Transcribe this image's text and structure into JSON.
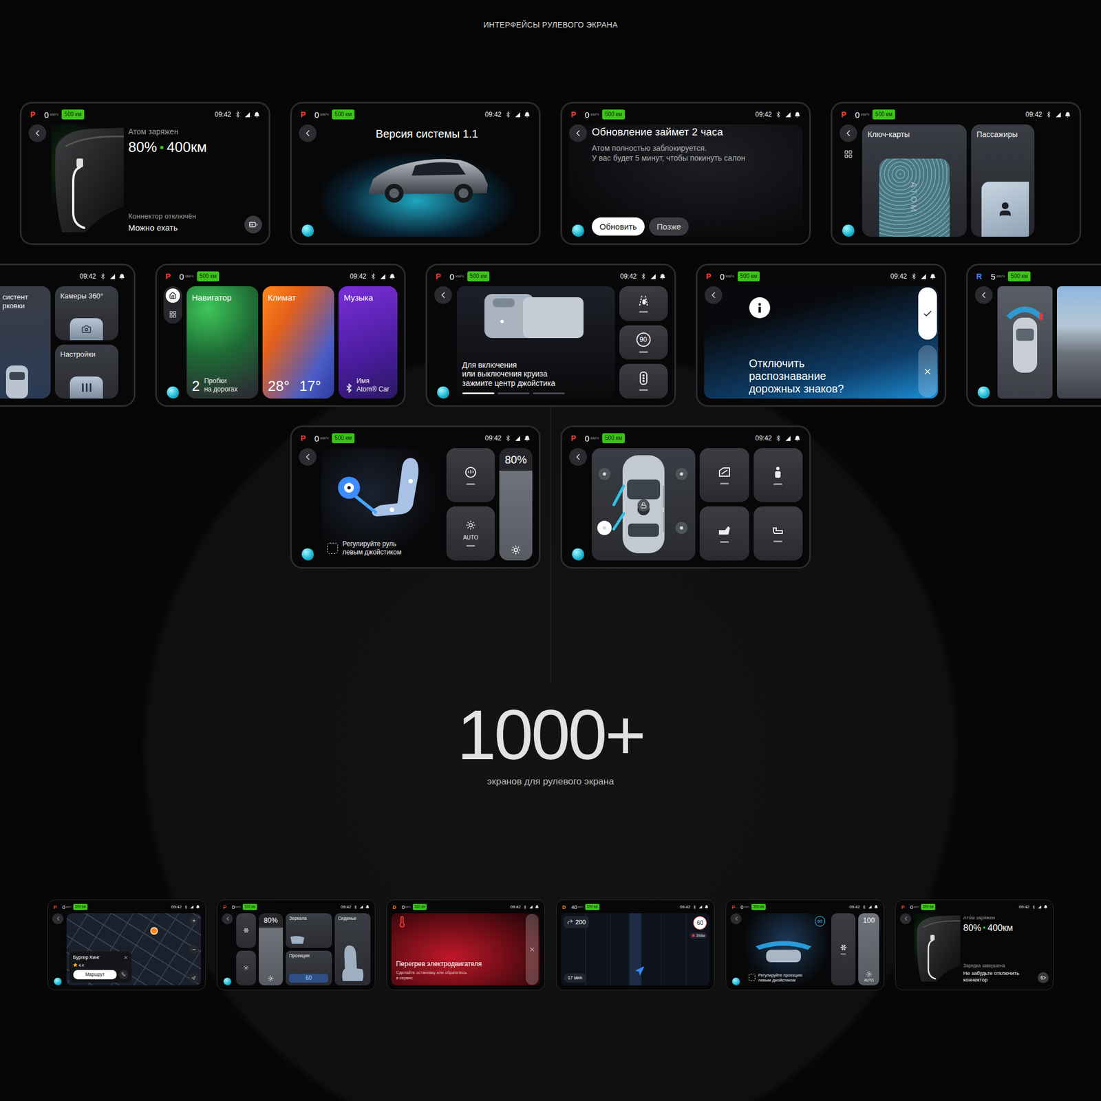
{
  "header": {
    "title": "ИНТЕРФЕЙСЫ РУЛЕВОГО ЭКРАНА"
  },
  "rows": [
    [
      {
        "kind": "charge",
        "status": {
          "gear": "P",
          "gear_color": "#ff3b30",
          "speed": "0",
          "unit": "км/ч",
          "range": "500 км",
          "time": "09:42"
        },
        "title": "Атом заряжен",
        "charge": "80%",
        "range": "400км",
        "note": "Коннектор отключён",
        "message": "Можно ехать"
      },
      {
        "kind": "version",
        "status": {
          "gear": "P",
          "gear_color": "#ff3b30",
          "speed": "0",
          "unit": "км/ч",
          "range": "500 км",
          "time": "09:42"
        },
        "title": "Версия системы 1.1"
      },
      {
        "kind": "update",
        "status": {
          "gear": "P",
          "gear_color": "#ff3b30",
          "speed": "0",
          "unit": "км/ч",
          "range": "500 км",
          "time": "09:42"
        },
        "title": "Обновление займет 2 часа",
        "lines": [
          "Атом полностью заблокируется.",
          "У вас будет 5 минут, чтобы покинуть салон"
        ],
        "buttons": [
          {
            "label": "Обновить",
            "primary": true
          },
          {
            "label": "Позже",
            "primary": false
          }
        ]
      },
      {
        "kind": "keys",
        "status": {
          "gear": "P",
          "gear_color": "#ff3b30",
          "speed": "0",
          "unit": "км/ч",
          "range": "500 км",
          "time": "09:42"
        },
        "cards": [
          {
            "label": "Ключ-карты",
            "card_text": "ATOM"
          },
          {
            "label": "Пассажиры"
          }
        ]
      }
    ],
    [
      {
        "kind": "apps",
        "status": {
          "time": "09:42"
        },
        "tiles": [
          {
            "lines": [
              "систент",
              "рковки"
            ]
          },
          {
            "lines": [
              "Камеры 360°"
            ]
          },
          {
            "lines": [
              "Настройки"
            ]
          }
        ]
      },
      {
        "kind": "home",
        "status": {
          "gear": "P",
          "gear_color": "#ff3b30",
          "speed": "0",
          "unit": "км/ч",
          "range": "500 км",
          "time": "09:42"
        },
        "nav": [
          {
            "selected": true
          },
          {
            "selected": false
          }
        ],
        "cards": [
          {
            "title": "Навигатор",
            "value": "2",
            "lines": [
              "Пробки",
              "на дорогах"
            ]
          },
          {
            "title": "Климат",
            "temps": [
              "28°",
              "17°"
            ]
          },
          {
            "title": "Музыка",
            "lines": [
              "Имя",
              "Atom® Car"
            ]
          }
        ]
      },
      {
        "kind": "cruise",
        "status": {
          "gear": "P",
          "gear_color": "#ff3b30",
          "speed": "0",
          "unit": "км/ч",
          "range": "500 км",
          "time": "09:42"
        },
        "hint": [
          "Для включения",
          "или выключения круиза",
          "зажмите центр джойстика"
        ],
        "speed_limit": "90",
        "pages": [
          {
            "selected": true
          },
          {
            "selected": false
          },
          {
            "selected": false
          }
        ]
      },
      {
        "kind": "confirm",
        "status": {
          "gear": "P",
          "gear_color": "#ff3b30",
          "speed": "0",
          "unit": "км/ч",
          "range": "500 км",
          "time": "09:42"
        },
        "question": [
          "Отключить",
          "распознавание",
          "дорожных знаков?"
        ]
      },
      {
        "kind": "camera",
        "status": {
          "gear": "R",
          "gear_color": "#3b8bff",
          "speed": "5",
          "unit": "км/ч",
          "range": "500 км"
        }
      }
    ],
    [
      {
        "kind": "steering",
        "status": {
          "gear": "P",
          "gear_color": "#ff3b30",
          "speed": "0",
          "unit": "км/ч",
          "range": "500 км",
          "time": "09:42"
        },
        "hint": [
          "Регулируйте руль",
          "левым джойстиком"
        ],
        "mode": "AUTO",
        "slider": {
          "reading": "80%",
          "level": 0.8
        }
      },
      {
        "kind": "doors",
        "status": {
          "gear": "P",
          "gear_color": "#ff3b30",
          "speed": "0",
          "unit": "км/ч",
          "range": "500 км",
          "time": "09:42"
        },
        "locked": false,
        "doors": [
          {
            "open": true
          },
          {
            "open": true
          },
          {
            "open": false
          },
          {
            "open": false
          }
        ],
        "speakers": [
          {
            "selected": false
          },
          {
            "selected": false
          },
          {
            "selected": true
          },
          {
            "selected": false
          }
        ]
      }
    ]
  ],
  "counter": {
    "value": "1000+",
    "caption": "экранов для рулевого экрана"
  },
  "bottom": [
    {
      "kind": "map",
      "status": {
        "gear": "P",
        "gear_color": "#ff3b30",
        "speed": "0",
        "unit": "км/ч",
        "range": "500 км",
        "time": "09:42"
      },
      "place": {
        "name": "Бургер Кинг",
        "rating": "4.4",
        "action": "Маршрут"
      }
    },
    {
      "kind": "quick",
      "status": {
        "gear": "P",
        "gear_color": "#ff3b30",
        "speed": "0",
        "unit": "км/ч",
        "range": "500 км",
        "time": "09:42"
      },
      "slider": {
        "reading": "80%",
        "level": 0.8
      },
      "tiles": [
        {
          "label": "Зеркала"
        },
        {
          "label": "Сиденье"
        },
        {
          "label": "Проекция",
          "value": "60"
        }
      ]
    },
    {
      "kind": "alert",
      "status": {
        "gear": "D",
        "gear_color": "#ff8a1f",
        "speed": "0",
        "unit": "км/ч",
        "range": "500 км",
        "time": "09:42"
      },
      "title": "Перегрев электродвигателя",
      "lines": [
        "Сделайте остановку или обратитесь",
        "в сервис"
      ]
    },
    {
      "kind": "route",
      "status": {
        "gear": "D",
        "gear_color": "#ff8a1f",
        "speed": "40",
        "unit": "км/ч",
        "range": "500 км",
        "time": "09:42"
      },
      "turn": "200",
      "limit": "60",
      "camera": "398м",
      "eta": "17 мин"
    },
    {
      "kind": "projection",
      "status": {
        "gear": "P",
        "gear_color": "#ff3b30",
        "speed": "0",
        "unit": "км/ч",
        "range": "500 км",
        "time": "09:42"
      },
      "badge": "60",
      "hint": [
        "Регулируйте проекцию",
        "левым джойстиком"
      ],
      "mode": "AUTO",
      "slider": {
        "reading": "100",
        "level": 1
      }
    },
    {
      "kind": "charge",
      "status": {
        "gear": "P",
        "gear_color": "#ff3b30",
        "speed": "0",
        "unit": "км/ч",
        "range": "500 км",
        "time": "09:42"
      },
      "title": "Атом заряжен",
      "charge": "80%",
      "range": "400км",
      "note": "Зарядка завершена",
      "message": "Не забудьте отключить коннектор"
    }
  ]
}
